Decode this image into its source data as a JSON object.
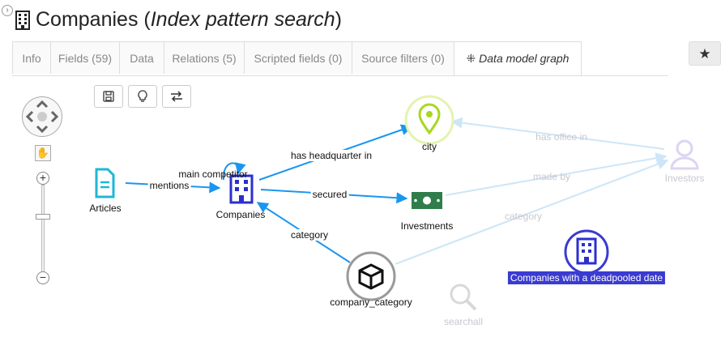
{
  "header": {
    "title_main": "Companies (",
    "title_italic": "Index pattern search",
    "title_end": ")"
  },
  "tabs": [
    {
      "label": "Info"
    },
    {
      "label": "Fields (59)"
    },
    {
      "label": "Data"
    },
    {
      "label": "Relations (5)"
    },
    {
      "label": "Scripted fields (0)"
    },
    {
      "label": "Source filters (0)"
    },
    {
      "label": "Data model graph",
      "active": true
    }
  ],
  "toolbar": {
    "save": "save-icon",
    "hint": "lightbulb-icon",
    "swap": "swap-icon",
    "star": "★"
  },
  "nav": {
    "zoom_in": "+",
    "zoom_out": "−",
    "pan": "hand-icon"
  },
  "graph": {
    "nodes": {
      "articles": "Articles",
      "companies": "Companies",
      "city": "city",
      "investments": "Investments",
      "investors": "Investors",
      "company_category": "company_category",
      "deadpooled": "Companies with a deadpooled date",
      "searchall": "searchall"
    },
    "edges": {
      "mentions": "mentions",
      "main_competitor": "main competitor",
      "has_headquarter_in": "has headquarter in",
      "secured": "secured",
      "category": "category",
      "has_office_in": "has office in",
      "made_by": "made by",
      "category_faded": "category"
    },
    "colors": {
      "active_edge": "#1a96f0",
      "faded_edge": "#cde6f7",
      "company": "#2b2fcf",
      "city": "#bfe33a",
      "investments": "#2e7d4a"
    }
  }
}
